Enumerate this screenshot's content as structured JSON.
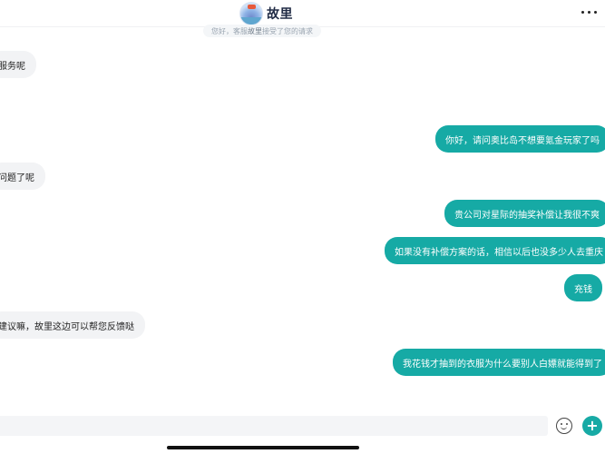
{
  "header": {
    "title": "故里",
    "avatar_icon": "game-logo-avatar",
    "more_icon": "more-dots-icon"
  },
  "system_notice": {
    "prefix": "您好，客服",
    "agent": "故里",
    "suffix": "接受了您的请求"
  },
  "messages": [
    {
      "side": "in",
      "text": "您服务呢"
    },
    {
      "side": "out",
      "text": "你好，请问奥比岛不想要氪金玩家了吗"
    },
    {
      "side": "in",
      "text": "么问题了呢"
    },
    {
      "side": "out",
      "text": "贵公司对星际的抽奖补偿让我很不爽"
    },
    {
      "side": "out",
      "text": "如果没有补偿方案的话，相信以后也没多少人去重庆"
    },
    {
      "side": "out",
      "text": "充钱"
    },
    {
      "side": "in",
      "text": "么建议嘛，故里这边可以帮您反馈哒"
    },
    {
      "side": "out",
      "text": "我花钱才抽到的衣服为什么要别人白嫖就能得到了"
    }
  ],
  "input": {
    "placeholder": "",
    "emoji_icon": "emoji-icon",
    "plus_icon": "plus-icon",
    "plus_label": "+"
  },
  "colors": {
    "outgoing_bubble": "#16aaa5",
    "incoming_bubble": "#f2f3f5"
  }
}
